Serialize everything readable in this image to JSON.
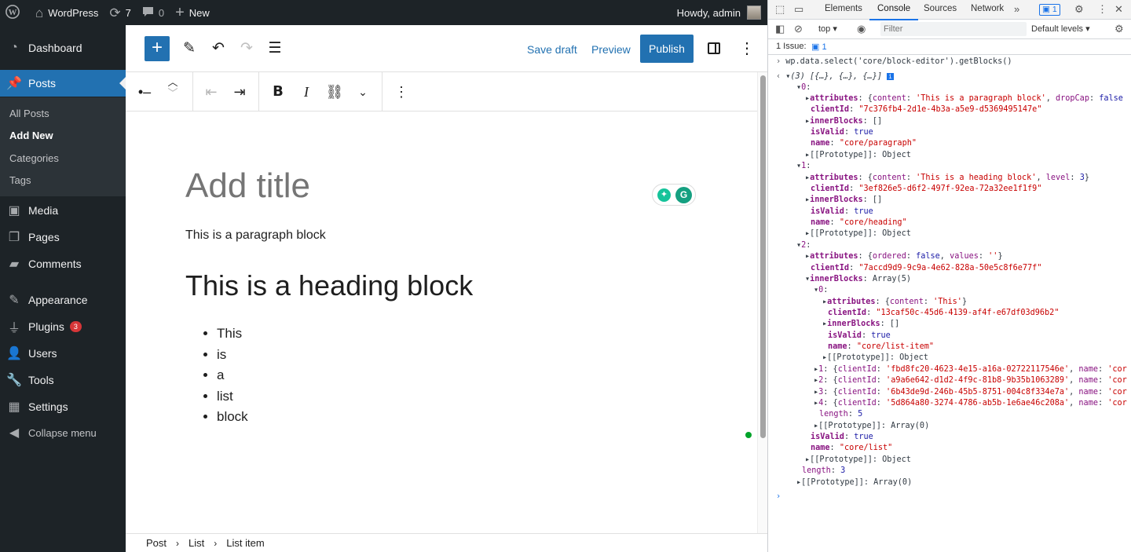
{
  "admin_bar": {
    "site_name": "WordPress",
    "updates_count": "7",
    "comments_count": "0",
    "new_label": "New",
    "greeting": "Howdy, admin"
  },
  "side_menu": {
    "items": [
      {
        "label": "Dashboard",
        "icon": "dashboard-icon"
      },
      {
        "label": "Posts",
        "icon": "pin-icon"
      },
      {
        "label": "Media",
        "icon": "media-icon"
      },
      {
        "label": "Pages",
        "icon": "pages-icon"
      },
      {
        "label": "Comments",
        "icon": "comment-icon"
      },
      {
        "label": "Appearance",
        "icon": "brush-icon"
      },
      {
        "label": "Plugins",
        "icon": "plug-icon",
        "badge": "3"
      },
      {
        "label": "Users",
        "icon": "user-icon"
      },
      {
        "label": "Tools",
        "icon": "wrench-icon"
      },
      {
        "label": "Settings",
        "icon": "settings-icon"
      },
      {
        "label": "Collapse menu",
        "icon": "collapse-icon"
      }
    ],
    "posts_submenu": [
      "All Posts",
      "Add New",
      "Categories",
      "Tags"
    ]
  },
  "editor_header": {
    "save_draft": "Save draft",
    "preview": "Preview",
    "publish": "Publish"
  },
  "canvas": {
    "title_placeholder": "Add title",
    "paragraph": "This is a paragraph block",
    "heading": "This is a heading block",
    "list_items": [
      "This",
      "is",
      "a",
      "list",
      "block"
    ]
  },
  "breadcrumb": [
    "Post",
    "List",
    "List item"
  ],
  "devtools": {
    "tabs": [
      "Elements",
      "Console",
      "Sources",
      "Network"
    ],
    "active_tab": "Console",
    "issue_badge": "1",
    "context": "top",
    "filter_placeholder": "Filter",
    "levels": "Default levels",
    "issues_text": "1 Issue:",
    "issues_count": "1",
    "command": "wp.data.select('core/block-editor').getBlocks()",
    "result_summary": "(3) [{…}, {…}, {…}]",
    "blocks": [
      {
        "clientId": "7c376fb4-2d1e-4b3a-a5e9-d5369495147e",
        "name": "core/paragraph",
        "content": "This is a paragraph block"
      },
      {
        "clientId": "3ef826e5-d6f2-497f-92ea-72a32ee1f1f9",
        "name": "core/heading",
        "content": "This is a heading block",
        "level": 3
      },
      {
        "clientId": "7accd9d9-9c9a-4e62-828a-50e5c8f6e77f",
        "name": "core/list",
        "inner_length": 5
      }
    ],
    "list_items": [
      {
        "clientId": "13caf50c-45d6-4139-af4f-e67df03d96b2",
        "name": "core/list-item",
        "content": "This"
      },
      {
        "clientId": "fbd8fc20-4623-4e15-a16a-02722117546e"
      },
      {
        "clientId": "a9a6e642-d1d2-4f9c-81b8-9b35b1063289"
      },
      {
        "clientId": "6b43de9d-246b-45b5-8751-004c8f334e7a"
      },
      {
        "clientId": "5d864a80-3274-4786-ab5b-1e6ae46c208a"
      }
    ],
    "length_outer": "3"
  }
}
